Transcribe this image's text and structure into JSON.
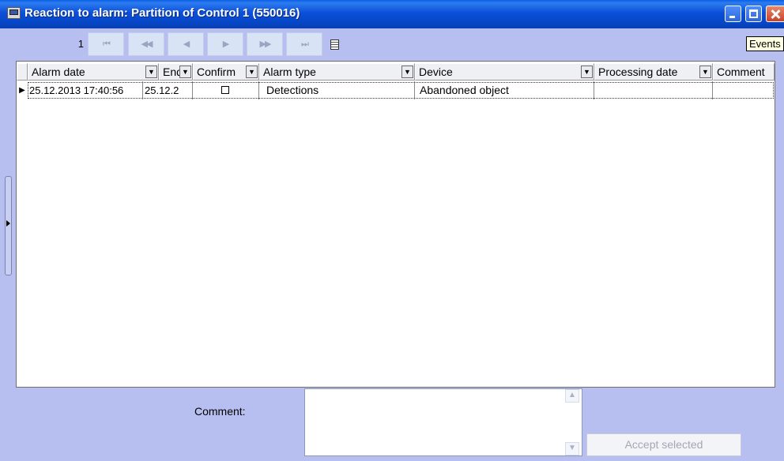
{
  "window": {
    "title": "Reaction to alarm: Partition of Control 1  (550016)",
    "tooltip": "Events"
  },
  "navigator": {
    "page": "1",
    "buttons": [
      {
        "name": "first",
        "glyph": "⏮"
      },
      {
        "name": "prior-page",
        "glyph": "◀◀"
      },
      {
        "name": "prior",
        "glyph": "◀"
      },
      {
        "name": "next",
        "glyph": "▶"
      },
      {
        "name": "next-page",
        "glyph": "▶▶"
      },
      {
        "name": "last",
        "glyph": "⏭"
      }
    ]
  },
  "grid": {
    "columns": [
      {
        "label": "Alarm date",
        "dropdown": true
      },
      {
        "label": "End",
        "dropdown": true
      },
      {
        "label": "Confirm",
        "dropdown": true
      },
      {
        "label": "Alarm type",
        "dropdown": true
      },
      {
        "label": "Device",
        "dropdown": true
      },
      {
        "label": "Processing date",
        "dropdown": true
      },
      {
        "label": "Comment",
        "dropdown": false
      }
    ],
    "rows": [
      {
        "alarm_date": "25.12.2013 17:40:56",
        "end": "25.12.2",
        "confirm": false,
        "alarm_type": "Detections",
        "device": "Abandoned object",
        "processing_date": "",
        "comment": ""
      }
    ]
  },
  "bottom": {
    "comment_label": "Comment:",
    "comment_value": "",
    "accept_label": "Accept selected"
  },
  "colors": {
    "titlebar": "#0a4fd9",
    "window_bg": "#b7bff0",
    "tooltip_bg": "#ffffe1",
    "close_button": "#c8422a"
  }
}
